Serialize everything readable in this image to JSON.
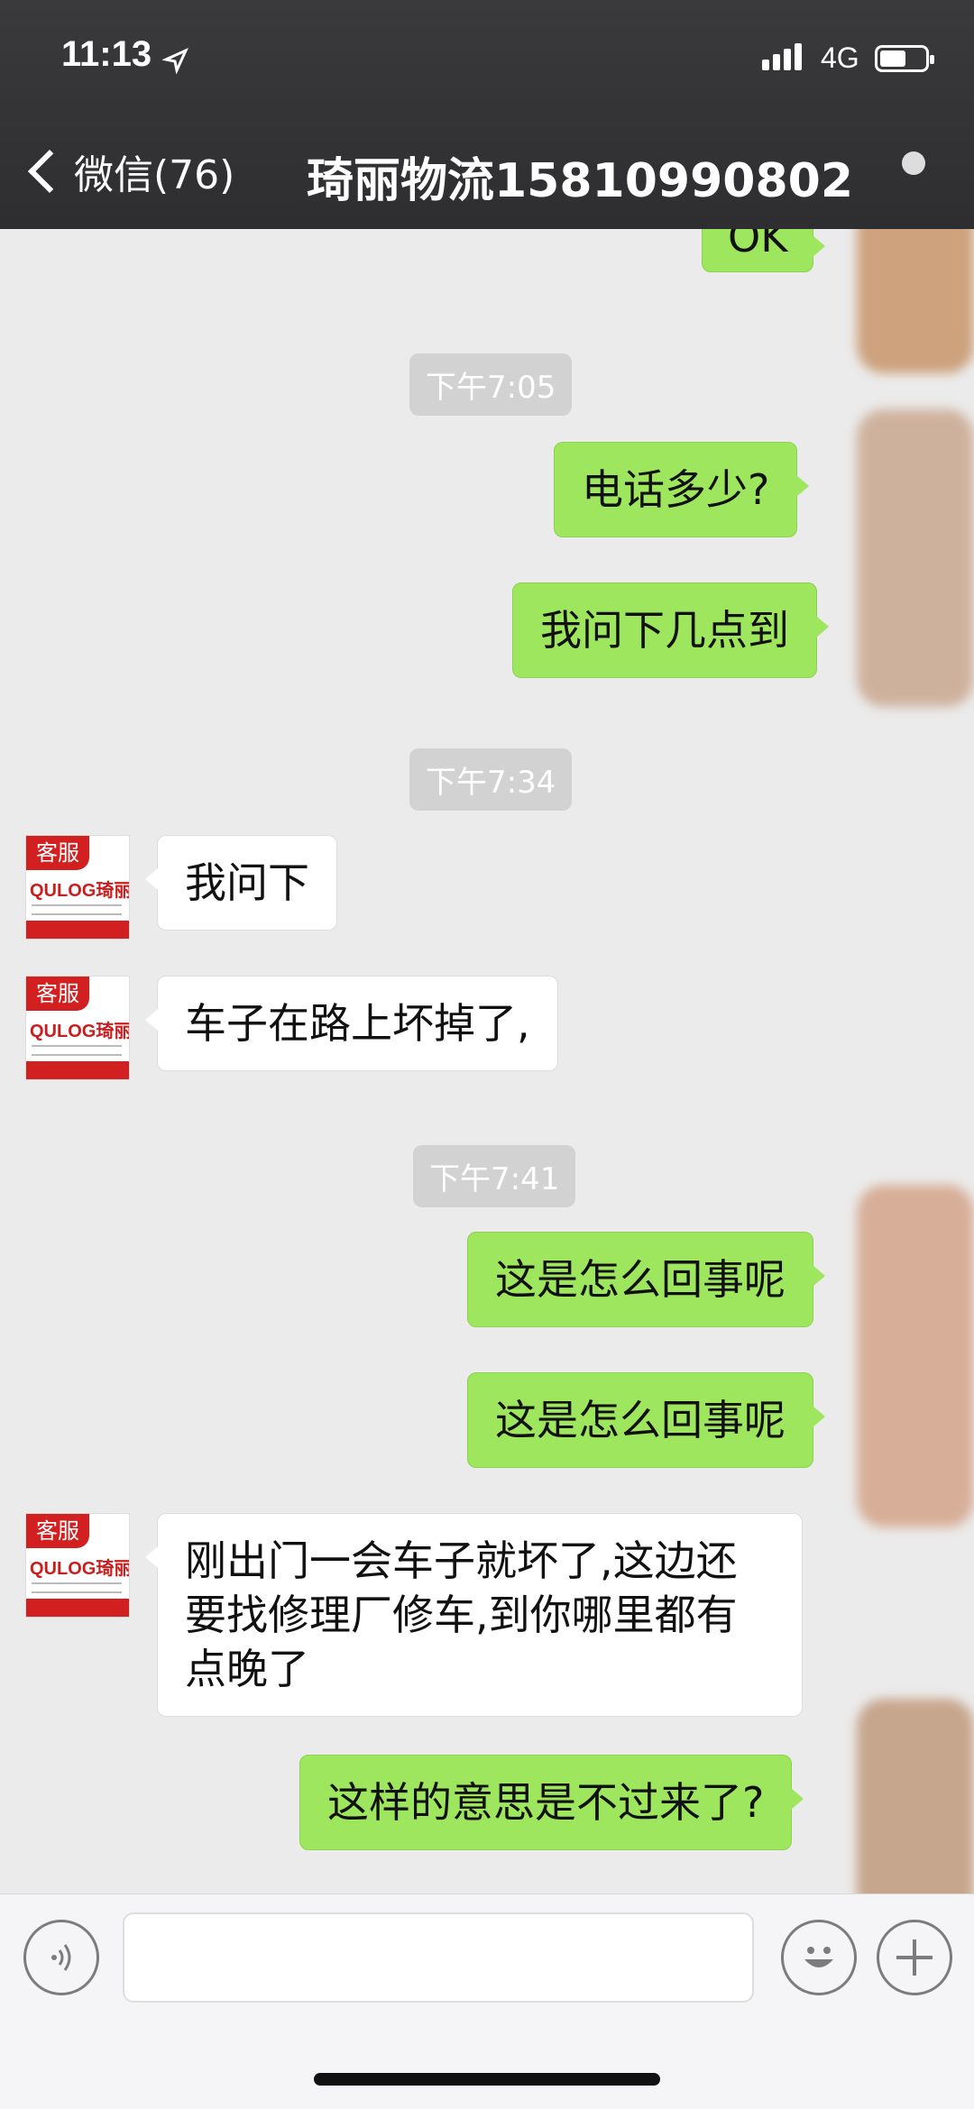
{
  "status_bar": {
    "time": "11:13",
    "network": "4G"
  },
  "header": {
    "back_label": "微信(76)",
    "title": "琦丽物流15810990802"
  },
  "messages": {
    "partial_top": "OK",
    "ts1": "下午7:05",
    "out1": "电话多少?",
    "out2": "我问下几点到",
    "ts2": "下午7:34",
    "in1": "我问下",
    "in2": "车子在路上坏掉了,",
    "ts3": "下午7:41",
    "out3": "这是怎么回事呢",
    "out4": "这是怎么回事呢",
    "in3_line1": "刚出门一会车子就坏了,这边还",
    "in3_line2": "要找修理厂修车,到你哪里都有",
    "in3_line3": "点晚了",
    "out5": "这样的意思是不过来了?"
  },
  "avatar": {
    "tag": "客服",
    "logo": "QULOG琦丽物流"
  },
  "input_bar": {
    "voice_icon": "voice-icon",
    "emoji_icon": "emoji-icon",
    "plus_icon": "plus-icon"
  },
  "colors": {
    "outgoing_bubble": "#9ee65e",
    "incoming_bubble": "#ffffff",
    "header_bg": "#2e2e30",
    "avatar_red": "#d21f1f"
  }
}
